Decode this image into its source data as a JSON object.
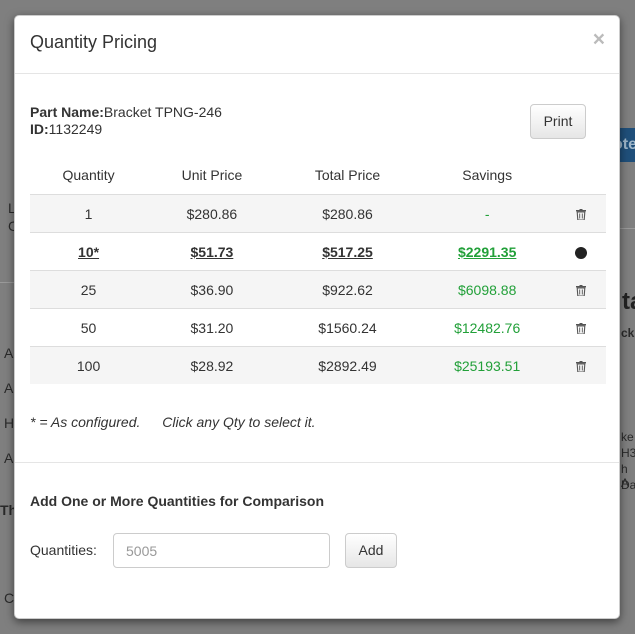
{
  "background": {
    "tab_fragment": "ote",
    "big_fragment": "ta",
    "side_fragments": [
      "L",
      "C",
      "A",
      "A",
      "H",
      "A",
      "Th",
      "C"
    ],
    "right_fragments": [
      "ck",
      "ke",
      "H3",
      "h A",
      "Day"
    ]
  },
  "modal": {
    "title": "Quantity Pricing",
    "close_glyph": "×",
    "part": {
      "name_label": "Part Name:",
      "name_value": "Bracket TPNG-246",
      "id_label": "ID:",
      "id_value": "1132249"
    },
    "print_label": "Print",
    "table": {
      "headers": [
        "Quantity",
        "Unit Price",
        "Total Price",
        "Savings",
        ""
      ],
      "rows": [
        {
          "qty": "1",
          "unit": "$280.86",
          "total": "$280.86",
          "savings": "-",
          "action": "trash-icon",
          "selected": false
        },
        {
          "qty": "10*",
          "unit": "$51.73",
          "total": "$517.25",
          "savings": "$2291.35",
          "action": "selected-dot-icon",
          "selected": true
        },
        {
          "qty": "25",
          "unit": "$36.90",
          "total": "$922.62",
          "savings": "$6098.88",
          "action": "trash-icon",
          "selected": false
        },
        {
          "qty": "50",
          "unit": "$31.20",
          "total": "$1560.24",
          "savings": "$12482.76",
          "action": "trash-icon",
          "selected": false
        },
        {
          "qty": "100",
          "unit": "$28.92",
          "total": "$2892.49",
          "savings": "$25193.51",
          "action": "trash-icon",
          "selected": false
        }
      ]
    },
    "note_configured": "* = As configured.",
    "note_select": "Click any Qty to select it.",
    "compare": {
      "title": "Add One or More Quantities for Comparison",
      "label": "Quantities:",
      "placeholder": "5005",
      "add_label": "Add"
    }
  },
  "colors": {
    "savings": "#22a039",
    "overlay": "#7f7f7f",
    "accent_tab": "#1f4f7a"
  }
}
